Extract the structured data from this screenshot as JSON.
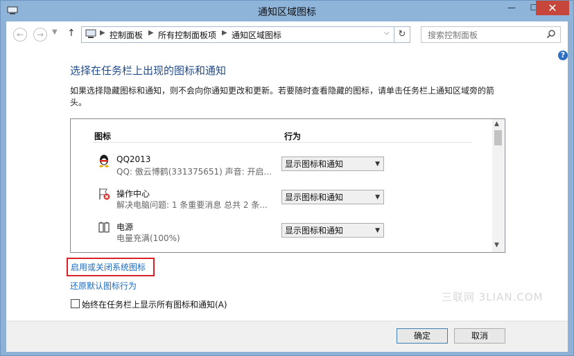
{
  "window": {
    "title": "通知区域图标"
  },
  "nav": {
    "breadcrumbs": [
      "控制面板",
      "所有控制面板项",
      "通知区域图标"
    ],
    "search_placeholder": "搜索控制面板"
  },
  "main": {
    "heading": "选择在任务栏上出现的图标和通知",
    "description": "如果选择隐藏图标和通知，则不会向你通知更改和更新。若要随时查看隐藏的图标，请单击任务栏上通知区域旁的箭头。",
    "columns": {
      "icon": "图标",
      "behavior": "行为"
    },
    "rows": [
      {
        "name": "QQ2013",
        "detail": "QQ: 傲云博鹤(331375651)  声音: 开启...",
        "behavior": "显示图标和通知",
        "icon": "qq-penguin-icon"
      },
      {
        "name": "操作中心",
        "detail": "解决电脑问题: 1 条重要消息  总共 2 条...",
        "behavior": "显示图标和通知",
        "icon": "action-center-flag-icon"
      },
      {
        "name": "电源",
        "detail": "电量充满(100%)",
        "behavior": "显示图标和通知",
        "icon": "battery-icon"
      }
    ],
    "link_system_icons": "启用或关闭系统图标",
    "link_restore": "还原默认图标行为",
    "checkbox_label": "始终在任务栏上显示所有图标和通知(A)",
    "checkbox_checked": false,
    "watermark": "三联网 3LIAN.COM"
  },
  "footer": {
    "ok": "确定",
    "cancel": "取消"
  },
  "colors": {
    "accent_link": "#1a6bc2",
    "heading": "#1f4b8c",
    "highlight_border": "#d72328",
    "close_button": "#c7463c"
  }
}
